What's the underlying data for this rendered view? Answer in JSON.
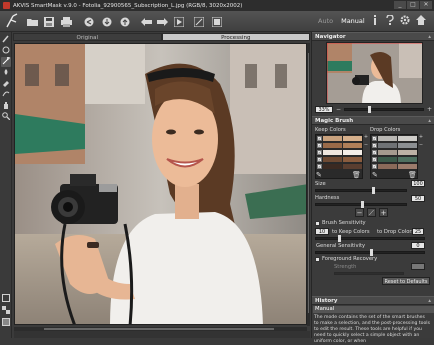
{
  "window": {
    "title": "AKVIS SmartMask v.9.0 - Fotolia_92900565_Subscription_L.jpg (RGB/8, 3020x2002)",
    "controls": [
      "_",
      "□",
      "✕"
    ]
  },
  "toolbar": {
    "mode_auto": "Auto",
    "mode_manual": "Manual",
    "icons": [
      "open-icon",
      "save-icon",
      "print-icon",
      "share-icon",
      "import-icon",
      "export-icon",
      "undo-icon",
      "redo-icon",
      "run-icon",
      "crop-icon",
      "preferences-icon"
    ],
    "right_icons": [
      "info-icon",
      "help-icon",
      "settings-icon",
      "home-icon"
    ]
  },
  "tabs": {
    "original": "Original",
    "processing": "Processing"
  },
  "navigator": {
    "title": "Navigator",
    "zoom": "33%",
    "zoom_out": "−",
    "zoom_in": "+"
  },
  "magic_brush": {
    "title": "Magic Brush",
    "keep_colors_label": "Keep Colors",
    "drop_colors_label": "Drop Colors",
    "keep_swatches": [
      [
        "#c9a27e",
        "#d6b08c"
      ],
      [
        "#9a6a48",
        "#b07f58"
      ],
      [
        "#efe7df",
        "#f4eee8"
      ],
      [
        "#6e4a33",
        "#8a5c3e"
      ],
      [
        "#3b2a22",
        "#5a3e30"
      ]
    ],
    "drop_swatches": [
      [
        "#b9b7b3",
        "#cfcdc9"
      ],
      [
        "#6f7275",
        "#8c8f92"
      ],
      [
        "#a59a8e",
        "#bdb1a5"
      ],
      [
        "#3c5a4a",
        "#4f7060"
      ],
      [
        "#8a6a5a",
        "#9c7c6c"
      ]
    ],
    "size_label": "Size",
    "size_value": "100",
    "hardness_label": "Hardness",
    "hardness_value": "50",
    "size_fraction": 0.62,
    "hardness_fraction": 0.5
  },
  "brush_sensitivity": {
    "title": "Brush Sensitivity",
    "keep_value": "10",
    "keep_label": "to Keep Colors",
    "drop_label": "to Drop Colors",
    "drop_value": "25",
    "general_label": "General Sensitivity",
    "general_value": "0"
  },
  "foreground_recovery": {
    "title": "Foreground Recovery",
    "strength_label": "Strength",
    "reset_label": "Reset to Defaults"
  },
  "history": {
    "title": "History",
    "selected": "Manual",
    "description": "The mode contains the set of the smart brushes to make a selection, and the post-processing tools to edit the result. These tools are helpful if you need to quickly select a simple object with an uniform color, or when"
  }
}
